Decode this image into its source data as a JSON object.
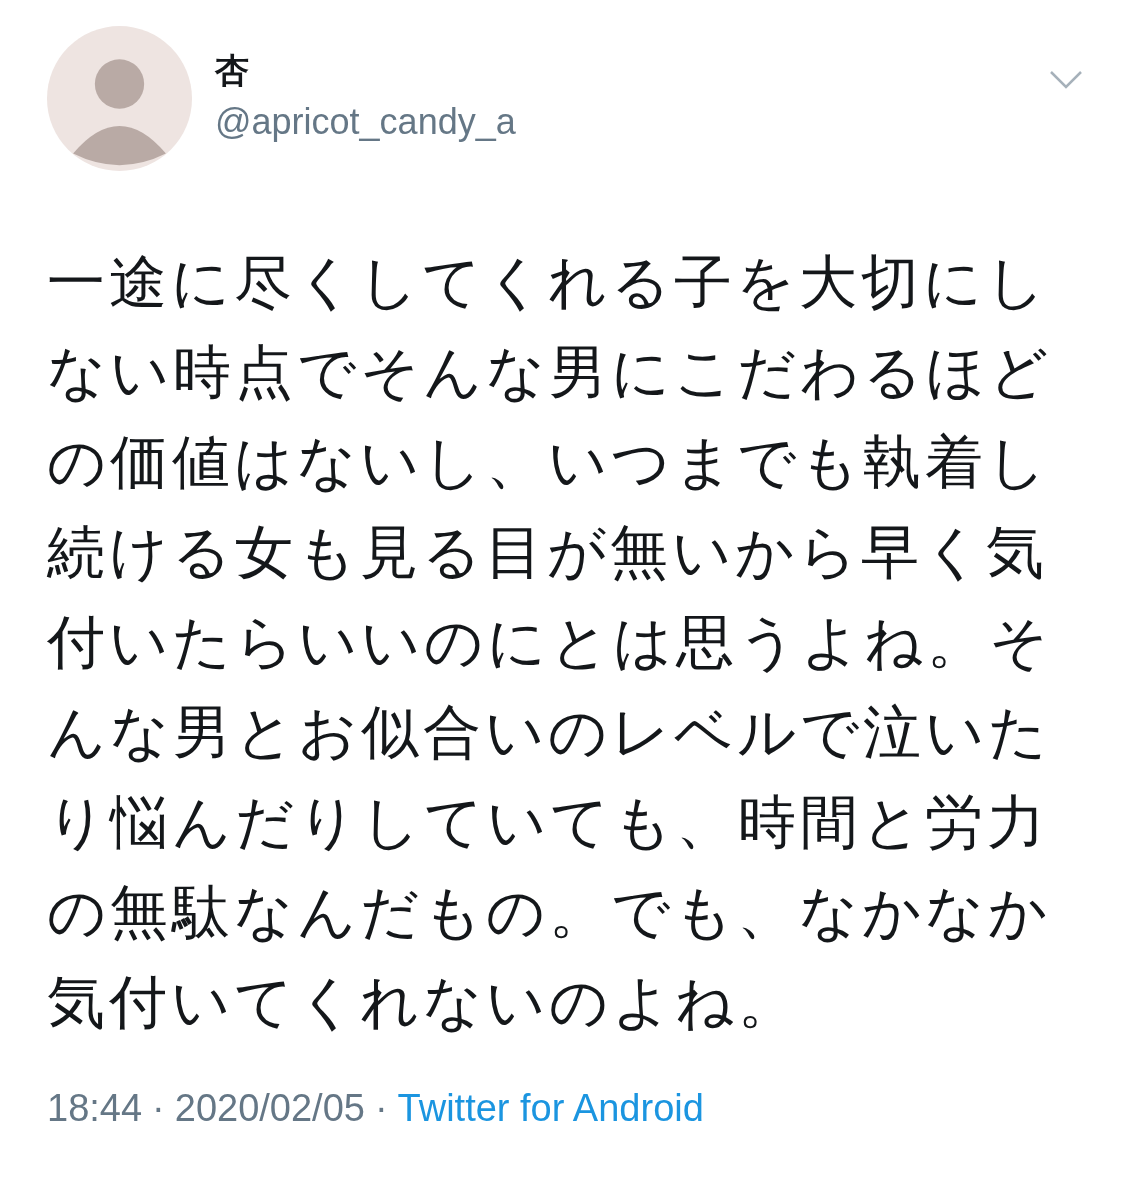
{
  "tweet": {
    "author": {
      "name": "杏",
      "handle": "@apricot_candy_a"
    },
    "text": "一途に尽くしてくれる子を大切にしない時点でそんな男にこだわるほどの価値はないし、いつまでも執着し続ける女も見る目が無いから早く気付いたらいいのにとは思うよね。そんな男とお似合いのレベルで泣いたり悩んだりしていても、時間と労力の無駄なんだもの。でも、なかなか気付いてくれないのよね。",
    "meta": [
      {
        "kind": "time",
        "text": "18:44"
      },
      {
        "kind": "separator",
        "text": "·"
      },
      {
        "kind": "date",
        "text": "2020/02/05"
      },
      {
        "kind": "separator",
        "text": "·"
      },
      {
        "kind": "source",
        "text": "Twitter for Android"
      }
    ]
  }
}
